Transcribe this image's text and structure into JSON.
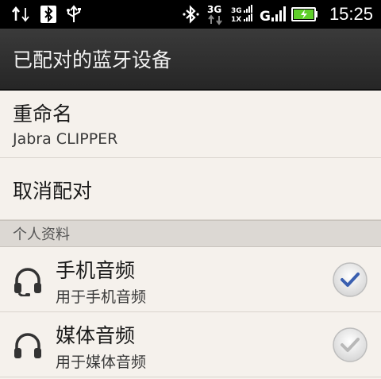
{
  "status_bar": {
    "time": "15:25",
    "network_3g": "3G",
    "network_3g_1x": "3G 1X",
    "network_g": "G"
  },
  "header": {
    "title": "已配对的蓝牙设备"
  },
  "rename": {
    "label": "重命名",
    "device_name": "Jabra CLIPPER"
  },
  "unpair": {
    "label": "取消配对"
  },
  "profiles": {
    "section_label": "个人资料",
    "items": [
      {
        "title": "手机音频",
        "subtitle": "用于手机音频",
        "checked": true,
        "check_color": "#3a5fb0"
      },
      {
        "title": "媒体音频",
        "subtitle": "用于媒体音频",
        "checked": true,
        "check_color": "#b8b8b8"
      }
    ]
  },
  "colors": {
    "background": "#f5f1ec",
    "title_bar": "#2e2e2e",
    "section_header": "#dcd8d3",
    "battery": "#5fcf2a"
  }
}
